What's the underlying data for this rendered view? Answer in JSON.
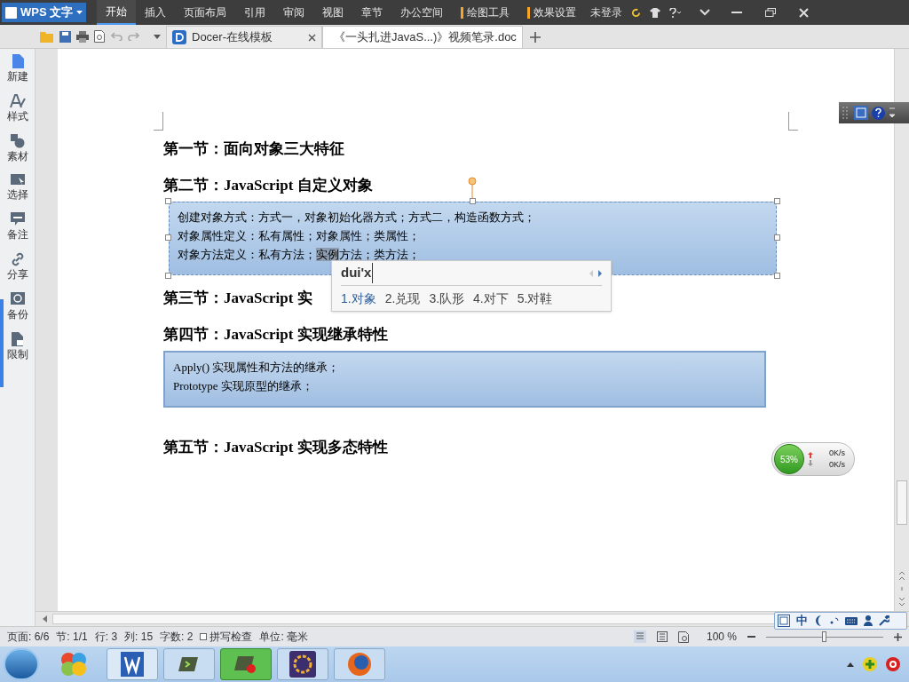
{
  "app_button": {
    "label": "WPS 文字"
  },
  "menu_tabs": [
    {
      "label": "开始",
      "selected": true,
      "kind": "main"
    },
    {
      "label": "插入",
      "selected": false,
      "kind": "main"
    },
    {
      "label": "页面布局",
      "selected": false,
      "kind": "main"
    },
    {
      "label": "引用",
      "selected": false,
      "kind": "main"
    },
    {
      "label": "审阅",
      "selected": false,
      "kind": "main"
    },
    {
      "label": "视图",
      "selected": false,
      "kind": "main"
    },
    {
      "label": "章节",
      "selected": false,
      "kind": "main"
    },
    {
      "label": "办公空间",
      "selected": false,
      "kind": "main"
    },
    {
      "label": "绘图工具",
      "selected": false,
      "kind": "context"
    },
    {
      "label": "效果设置",
      "selected": false,
      "kind": "context"
    }
  ],
  "login": "未登录",
  "doc_tabs": [
    {
      "label": "Docer-在线模板",
      "selected": false,
      "kind": "docer"
    },
    {
      "label": "《一头扎进JavaS...)》视频笔录.doc",
      "selected": true,
      "kind": "doc"
    }
  ],
  "sidebar": {
    "items": [
      {
        "label": "新建",
        "kind": "new"
      },
      {
        "label": "样式",
        "kind": "style"
      },
      {
        "label": "素材",
        "kind": "material"
      },
      {
        "label": "选择",
        "kind": "select"
      },
      {
        "label": "备注",
        "kind": "note"
      },
      {
        "label": "分享",
        "kind": "share"
      },
      {
        "label": "备份",
        "kind": "backup"
      },
      {
        "label": "限制",
        "kind": "limit"
      }
    ]
  },
  "document": {
    "blocks": [
      {
        "kind": "heading",
        "text": "第一节：面向对象三大特征"
      },
      {
        "kind": "heading",
        "text": "第二节：JavaScript 自定义对象"
      },
      {
        "kind": "textbox",
        "selected": true,
        "lines": [
          {
            "parts": [
              {
                "text": "创建对象方式：方式一，对象初始化器方式；方式二，构造函数方式；",
                "highlighted": false
              }
            ]
          },
          {
            "parts": [
              {
                "text": "对象属性定义：私有属性；对象属性；类属性；",
                "highlighted": false
              }
            ]
          },
          {
            "parts": [
              {
                "text": "对象方法定义：私有方法；",
                "highlighted": false
              },
              {
                "text": "实例",
                "highlighted": true
              },
              {
                "text": "方法；类方法；",
                "highlighted": false
              }
            ]
          }
        ]
      },
      {
        "kind": "heading",
        "text": "第三节：JavaScript 实"
      },
      {
        "kind": "heading",
        "text": "第四节：JavaScript 实现继承特性"
      },
      {
        "kind": "textbox",
        "selected": false,
        "lines": [
          {
            "parts": [
              {
                "text": "Apply()  实现属性和方法的继承；",
                "highlighted": false
              }
            ]
          },
          {
            "parts": [
              {
                "text": "Prototype 实现原型的继承；",
                "highlighted": false
              }
            ]
          }
        ]
      },
      {
        "kind": "heading",
        "text": "第五节：JavaScript 实现多态特性"
      }
    ]
  },
  "ime_popup": {
    "input": "dui'x",
    "candidates": [
      {
        "text": "1.对象",
        "selected": true
      },
      {
        "text": "2.兑现",
        "selected": false
      },
      {
        "text": "3.队形",
        "selected": false
      },
      {
        "text": "4.对下",
        "selected": false
      },
      {
        "text": "5.对鞋",
        "selected": false
      }
    ]
  },
  "net_meter": {
    "percent": "53%",
    "upload": "0K/s",
    "download": "0K/s"
  },
  "ime_toolbar": {
    "mode": "中"
  },
  "status_bar": {
    "items": [
      "页面: 6/6",
      "节: 1/1",
      "行: 3",
      "列: 15",
      "字数: 2"
    ],
    "spellcheck": {
      "label": "拼写检查",
      "checked": false
    },
    "unit": "单位: 毫米",
    "zoom": "100 %",
    "zoom_level": {
      "level": 0.5
    }
  }
}
